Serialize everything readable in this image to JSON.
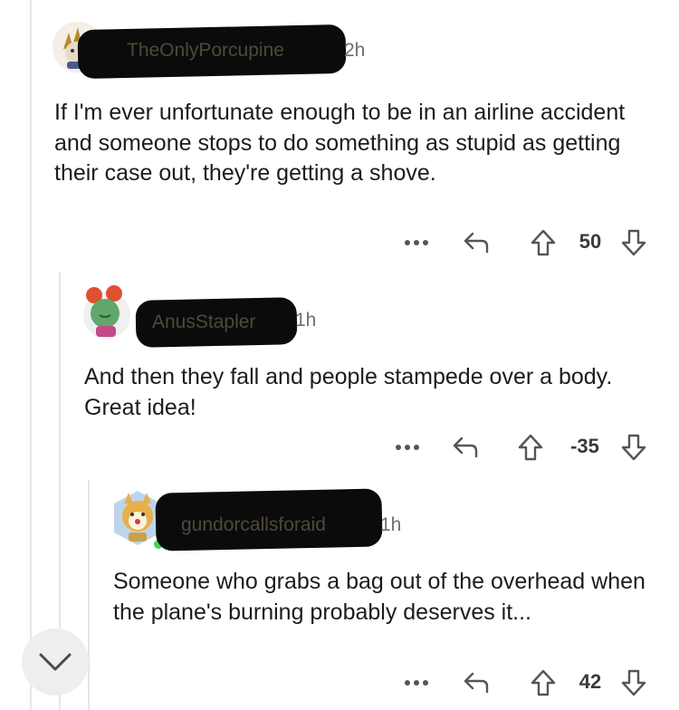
{
  "comments": [
    {
      "username": "TheOnlyPorcupine",
      "time": "2h",
      "body": "If I'm ever unfortunate enough to be in an airline accident and someone stops to do something as stupid as getting their case out, they're getting a shove.",
      "score": "50"
    },
    {
      "username": "AnusStapler",
      "time": "1h",
      "body": "And then they fall and people stampede over a body. Great idea!",
      "score": "-35"
    },
    {
      "username": "gundorcallsforaid",
      "time": "1h",
      "body": "Someone who grabs a bag out of the overhead when the plane's burning probably deserves it...",
      "score": "42"
    }
  ],
  "icons": {
    "more": "more-options-icon",
    "reply": "reply-arrow-icon",
    "upvote": "upvote-arrow-icon",
    "downvote": "downvote-arrow-icon",
    "collapse": "chevron-down-icon"
  },
  "colors": {
    "online": "#46d160",
    "redaction": "#0b0b0b",
    "icon_gray": "#6b6b6b"
  }
}
